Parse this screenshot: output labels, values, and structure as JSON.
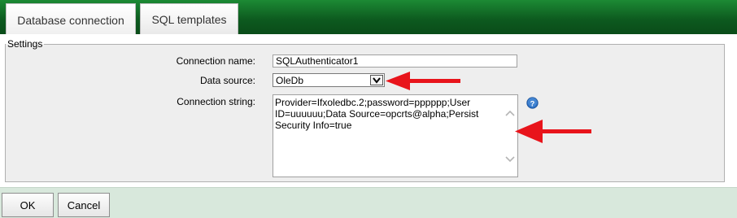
{
  "tabs": [
    {
      "label": "Database connection",
      "active": true
    },
    {
      "label": "SQL templates",
      "active": false
    }
  ],
  "settings": {
    "legend": "Settings",
    "connection_name": {
      "label": "Connection name:",
      "value": "SQLAuthenticator1"
    },
    "data_source": {
      "label": "Data source:",
      "selected": "OleDb"
    },
    "connection_string": {
      "label": "Connection string:",
      "line1": "Provider=Ifxoledbc.2;password=pppppp;User",
      "line2": "ID=uuuuuu;Data Source=opcrts@alpha;Persist",
      "line3": "Security Info=true"
    }
  },
  "icons": {
    "help": "help-icon",
    "dropdown": "chevron-down-icon"
  },
  "colors": {
    "tab_bar": "#0d5a1f",
    "annotation_arrow": "#e8141b",
    "footer": "#d8e8dc",
    "help_icon": "#2b6fc4"
  },
  "buttons": {
    "ok": "OK",
    "cancel": "Cancel"
  }
}
